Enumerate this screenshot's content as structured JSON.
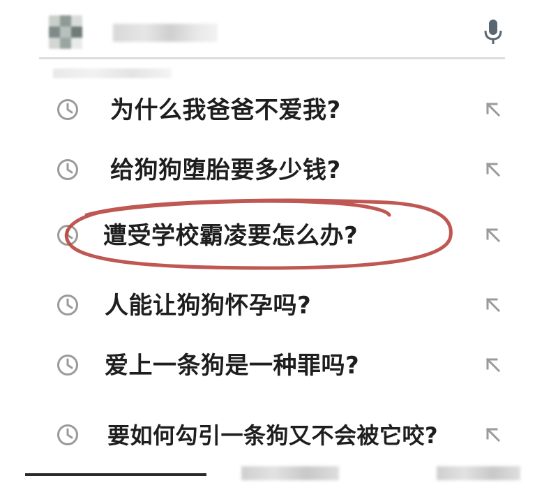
{
  "search": {
    "mic": "microphone-icon"
  },
  "suggestions": [
    {
      "text": "为什么我爸爸不爱我?",
      "icon": "history-clock-icon",
      "action_icon": "fill-query-arrow-icon"
    },
    {
      "text": "给狗狗堕胎要多少钱?",
      "icon": "history-clock-icon",
      "action_icon": "fill-query-arrow-icon"
    },
    {
      "text": "遭受学校霸凌要怎么办?",
      "icon": "history-clock-icon",
      "action_icon": "fill-query-arrow-icon",
      "highlighted": true
    },
    {
      "text": "人能让狗狗怀孕吗?",
      "icon": "history-clock-icon",
      "action_icon": "fill-query-arrow-icon"
    },
    {
      "text": "爱上一条狗是一种罪吗?",
      "icon": "history-clock-icon",
      "action_icon": "fill-query-arrow-icon"
    },
    {
      "text": "要如何勾引一条狗又不会被它咬?",
      "icon": "history-clock-icon",
      "action_icon": "fill-query-arrow-icon"
    }
  ],
  "colors": {
    "text": "#1e1e1e",
    "icon": "#9a9a9a",
    "highlight_circle": "#b8453f"
  }
}
